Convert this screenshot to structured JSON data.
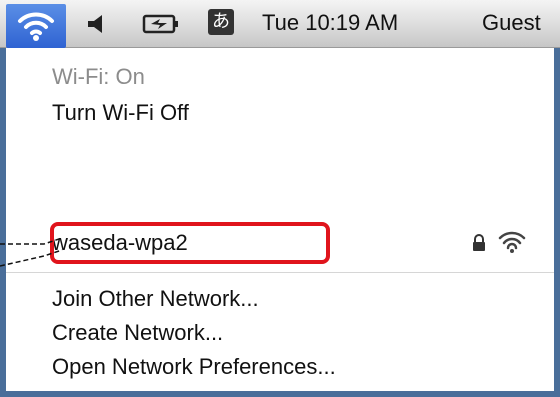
{
  "menubar": {
    "wifi_icon": "wifi-icon",
    "speaker_icon": "speaker-icon",
    "battery_icon": "battery-icon",
    "input_method_label": "あ",
    "clock": "Tue 10:19 AM",
    "user": "Guest"
  },
  "wifi_menu": {
    "status": "Wi-Fi: On",
    "toggle_label": "Turn Wi-Fi Off",
    "networks": [
      {
        "name": "waseda-wpa2",
        "secured": true,
        "lock_icon": "lock-icon",
        "signal_icon": "wifi-signal-icon"
      }
    ],
    "join_other_label": "Join Other Network...",
    "create_label": "Create Network...",
    "preferences_label": "Open Network Preferences..."
  },
  "colors": {
    "highlight_border": "#e0141c",
    "menubar_active": "#3b70d8",
    "frame": "#4a6e9a",
    "disabled_text": "#8c8c8c"
  }
}
